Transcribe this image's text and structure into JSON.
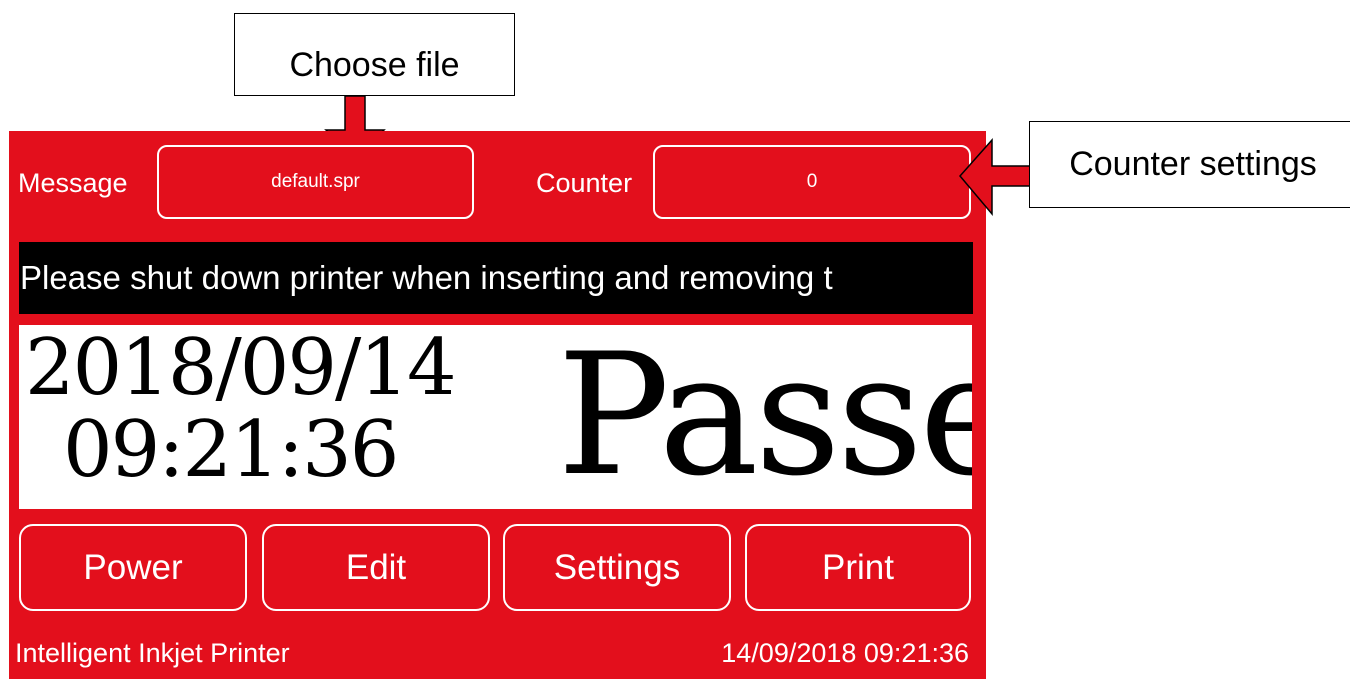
{
  "callouts": {
    "choose_file": "Choose file",
    "counter_settings": "Counter settings",
    "arrow_color": "#e30f1c"
  },
  "screen": {
    "background_color": "#e30f1c",
    "message_label": "Message",
    "message_value": "default.spr",
    "counter_label": "Counter",
    "counter_value": "0",
    "notice": "Please shut down printer when inserting and removing t",
    "display": {
      "date": "2018/09/14",
      "time": "09:21:36",
      "message": "Passe"
    },
    "buttons": {
      "power": "Power",
      "edit": "Edit",
      "settings": "Settings",
      "print": "Print"
    },
    "footer": {
      "title": "Intelligent Inkjet Printer",
      "datetime": "14/09/2018 09:21:36"
    }
  }
}
